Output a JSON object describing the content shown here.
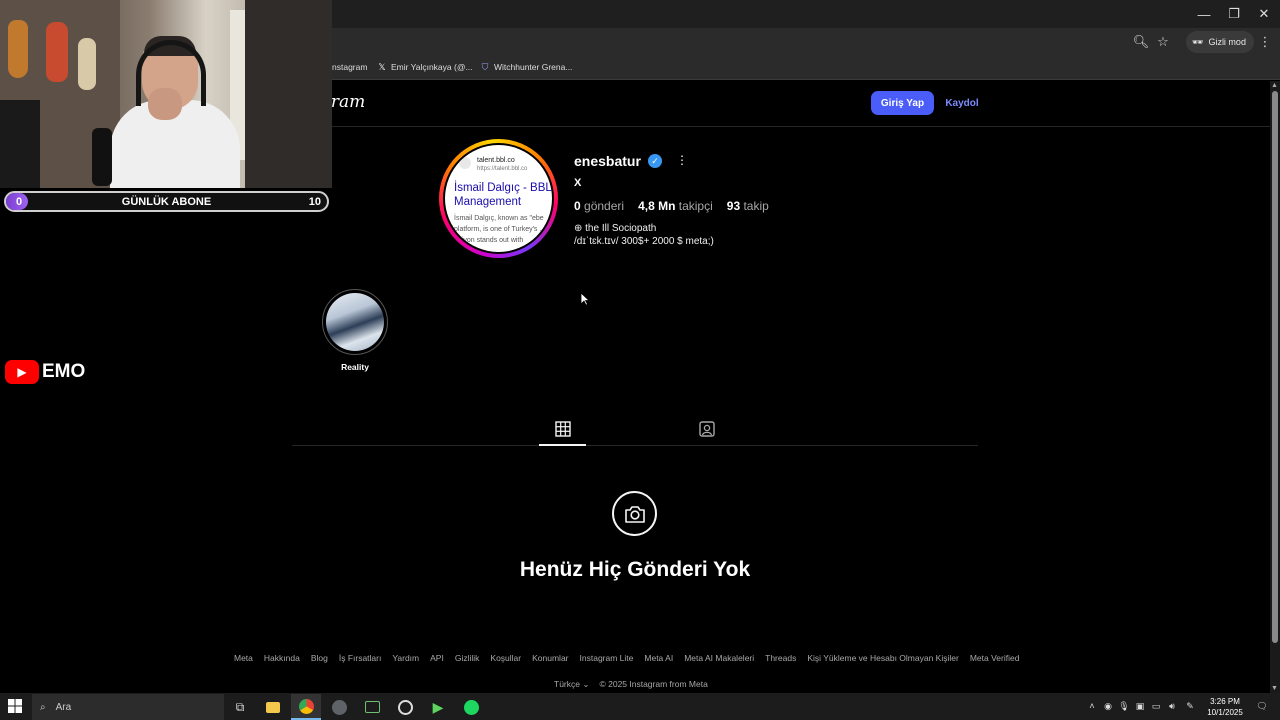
{
  "browser": {
    "incognito_label": "Gizli mod",
    "bookmarks": [
      {
        "label": "nstagram",
        "icon": "instagram-icon"
      },
      {
        "label": "Emir Yalçınkaya (@...",
        "icon": "x-logo-icon"
      },
      {
        "label": "Witchhunter Grena...",
        "icon": "shield-icon"
      }
    ]
  },
  "header": {
    "logo_text": "gram",
    "login_label": "Giriş Yap",
    "signup_label": "Kaydol"
  },
  "profile": {
    "username": "enesbatur",
    "full_name": "X",
    "posts_count": "0",
    "posts_label": "gönderi",
    "followers_count": "4,8 Mn",
    "followers_label": "takipçi",
    "following_count": "93",
    "following_label": "takip",
    "bio_line1": "⊕ the Ill Sociopath",
    "bio_line2": "/dɪˈtɛk.tɪv/ 300$+ 2000 $ meta;)",
    "avatar_preview": {
      "site": "talent.bbl.co",
      "url": "https://talent.bbl.co",
      "title": "İsmail Dalgıç - BBL Management",
      "desc": "İsmail Dalgıç, known as \"ebe platform, is one of Turkey's ... onivon stands out with"
    }
  },
  "highlights": [
    {
      "label": "Reality"
    }
  ],
  "empty_state": {
    "title": "Henüz Hiç Gönderi Yok"
  },
  "footer": {
    "links": [
      "Meta",
      "Hakkında",
      "Blog",
      "İş Fırsatları",
      "Yardım",
      "API",
      "Gizlilik",
      "Koşullar",
      "Konumlar",
      "Instagram Lite",
      "Meta AI",
      "Meta AI Makaleleri",
      "Threads",
      "Kişi Yükleme ve Hesabı Olmayan Kişiler",
      "Meta Verified"
    ],
    "language": "Türkçe",
    "copyright": "© 2025 Instagram from Meta"
  },
  "overlay": {
    "sub_min": "0",
    "sub_label": "GÜNLÜK ABONE",
    "sub_max": "10",
    "sub_progress": 0.06,
    "channel_text": "EMO"
  },
  "taskbar": {
    "search_placeholder": "Ara",
    "time": "3:26 PM",
    "date": "10/1/2025"
  },
  "colors": {
    "accent_button": "#4a5df9",
    "signup_link": "#7b8cff",
    "verified": "#3897f0",
    "youtube_red": "#ff0000"
  }
}
